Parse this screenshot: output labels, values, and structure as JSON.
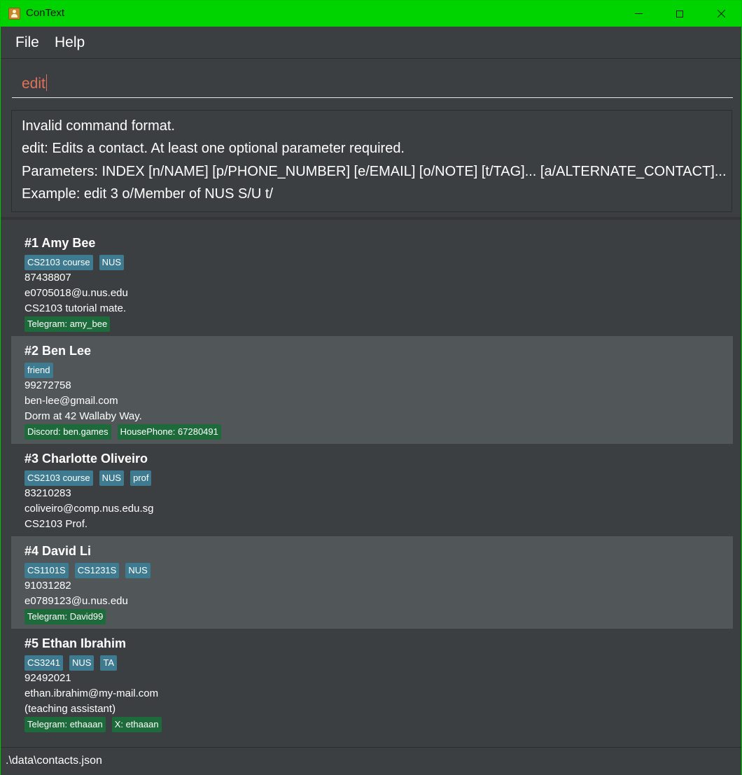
{
  "window": {
    "title": "ConText",
    "accent_color": "#00d400"
  },
  "menu": {
    "file": "File",
    "help": "Help"
  },
  "command": {
    "value": "edit"
  },
  "result": {
    "lines": [
      "Invalid command format.",
      "edit: Edits a contact. At least one optional parameter required.",
      "Parameters: INDEX [n/NAME] [p/PHONE_NUMBER] [e/EMAIL] [o/NOTE] [t/TAG]... [a/ALTERNATE_CONTACT]...",
      "Example: edit 3 o/Member of NUS S/U t/"
    ]
  },
  "contacts": [
    {
      "name": "#1 Amy Bee",
      "tags": [
        "CS2103 course",
        "NUS"
      ],
      "phone": "87438807",
      "email": "e0705018@u.nus.edu",
      "note": "CS2103 tutorial mate.",
      "alternates": [
        "Telegram: amy_bee"
      ]
    },
    {
      "name": "#2 Ben Lee",
      "tags": [
        "friend"
      ],
      "phone": "99272758",
      "email": "ben-lee@gmail.com",
      "note": "Dorm at 42 Wallaby Way.",
      "alternates": [
        "Discord: ben.games",
        "HousePhone: 67280491"
      ]
    },
    {
      "name": "#3 Charlotte Oliveiro",
      "tags": [
        "CS2103 course",
        "NUS",
        "prof"
      ],
      "phone": "83210283",
      "email": "coliveiro@comp.nus.edu.sg",
      "note": "CS2103 Prof.",
      "alternates": []
    },
    {
      "name": "#4 David Li",
      "tags": [
        "CS1101S",
        "CS1231S",
        "NUS"
      ],
      "phone": "91031282",
      "email": "e0789123@u.nus.edu",
      "note": "",
      "alternates": [
        "Telegram: David99"
      ]
    },
    {
      "name": "#5 Ethan Ibrahim",
      "tags": [
        "CS3241",
        "NUS",
        "TA"
      ],
      "phone": "92492021",
      "email": "ethan.ibrahim@my-mail.com",
      "note": "(teaching assistant)",
      "alternates": [
        "Telegram: ethaaan",
        "X: ethaaan"
      ]
    }
  ],
  "status": {
    "path": ".\\data\\contacts.json"
  },
  "colors": {
    "tag": "#3e7b91",
    "alternate_contact": "#1d6b3a",
    "command_text": "#e2725b",
    "card_dark": "#3c3f41",
    "card_light": "#515658"
  }
}
